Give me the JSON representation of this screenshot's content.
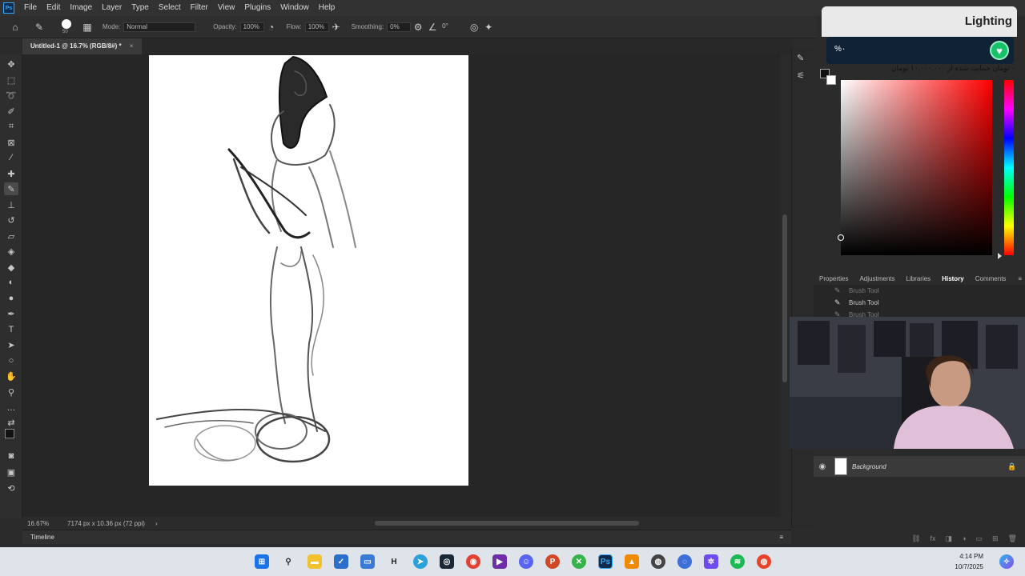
{
  "menubar": {
    "logo": "Ps",
    "items": [
      "File",
      "Edit",
      "Image",
      "Layer",
      "Type",
      "Select",
      "Filter",
      "View",
      "Plugins",
      "Window",
      "Help"
    ]
  },
  "options": {
    "brush_size": "50",
    "mode_label": "Mode:",
    "mode_value": "Normal",
    "opacity_label": "Opacity:",
    "opacity_value": "100%",
    "flow_label": "Flow:",
    "flow_value": "100%",
    "smoothing_label": "Smoothing:",
    "smoothing_value": "0%",
    "angle_value": "0°"
  },
  "document": {
    "tab_title": "Untitled-1 @ 16.7% (RGB/8#) *",
    "close": "×"
  },
  "status": {
    "zoom": "16.67%",
    "doc_info": "7174 px x 10.36 px (72 ppi)",
    "arrow": "›"
  },
  "timeline": {
    "label": "Timeline",
    "menu": "≡"
  },
  "donation": {
    "title": "Lighting",
    "percent": "%۰",
    "note": "۰ تومان حمایت شده از ۱۰,۰۰۰,۰۰۰ تومان"
  },
  "panel_tabs": [
    "Properties",
    "Adjustments",
    "Libraries",
    "History",
    "Comments"
  ],
  "active_panel": "History",
  "history": {
    "items": [
      "Brush Tool",
      "Brush Tool",
      "Brush Tool"
    ]
  },
  "layers": {
    "name": "Background"
  },
  "taskbar": {
    "time": "4:14 PM",
    "date": "10/7/2025"
  },
  "colors": {
    "accent": "#31a8ff",
    "heart": "#18c26b"
  }
}
